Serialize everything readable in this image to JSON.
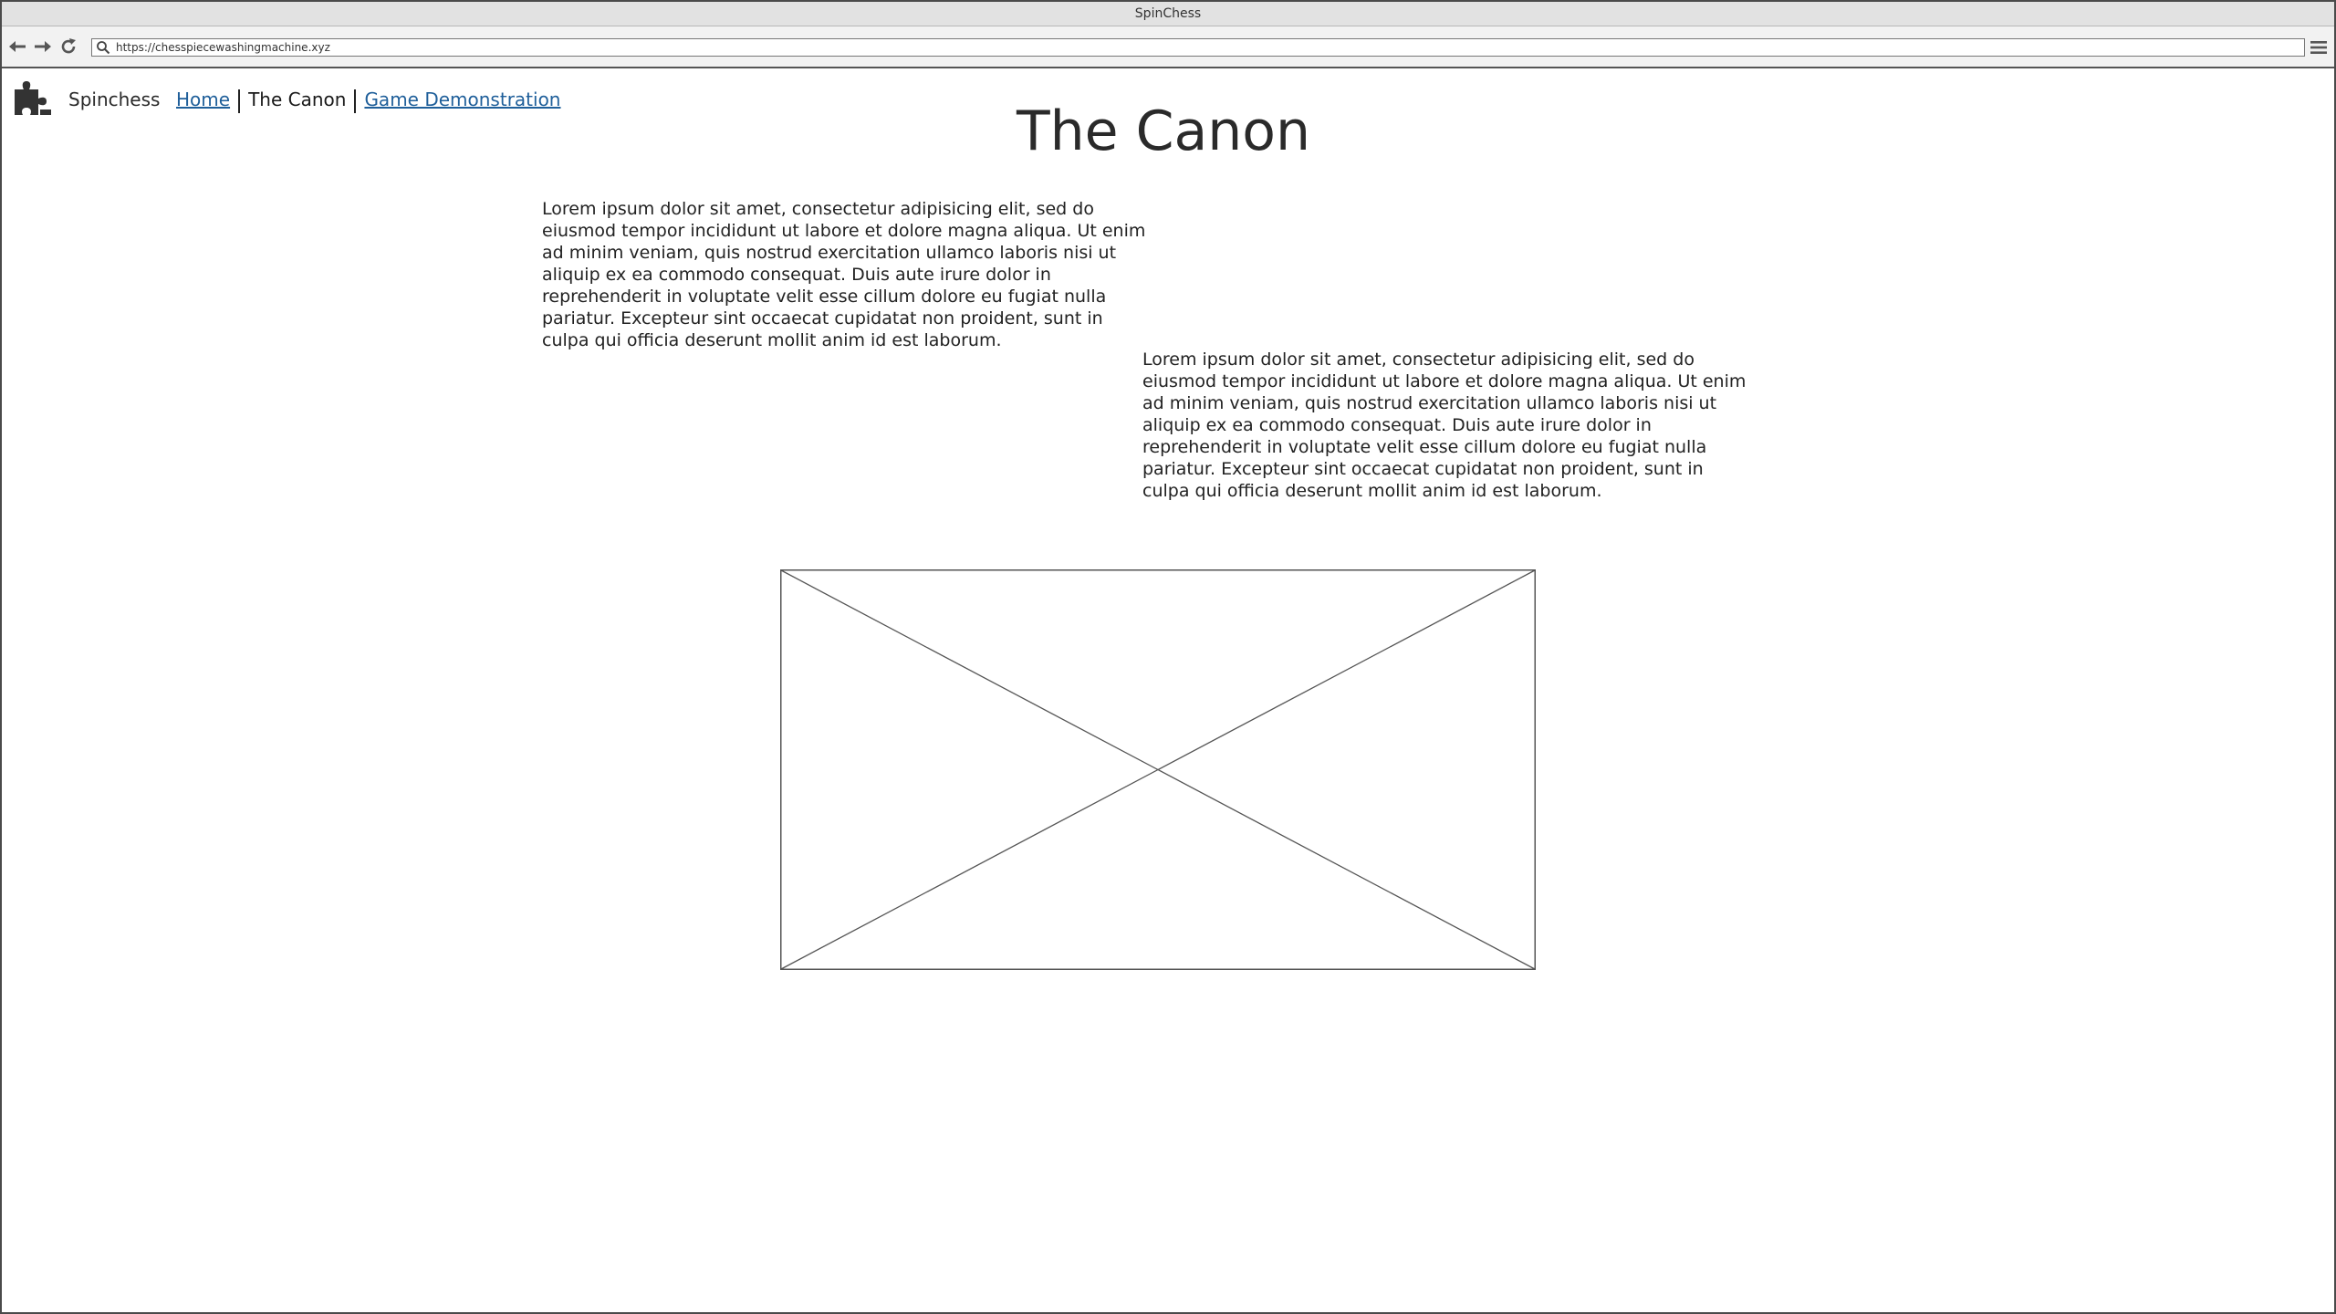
{
  "browser": {
    "window_title": "SpinChess",
    "url": "https://chesspiecewashingmachine.xyz",
    "icons": {
      "back": "back-arrow-icon",
      "forward": "forward-arrow-icon",
      "reload": "reload-icon",
      "search": "search-icon",
      "menu": "hamburger-menu-icon"
    }
  },
  "site": {
    "logo_icon": "puzzle-piece-icon",
    "brand": "Spinchess",
    "nav": {
      "home": "Home",
      "canon": "The Canon",
      "demo": "Game Demonstration"
    }
  },
  "main": {
    "title": "The Canon",
    "paragraphs": [
      "Lorem ipsum dolor sit amet, consectetur adipisicing elit, sed do eiusmod tempor incididunt ut labore et dolore magna aliqua. Ut enim ad minim veniam, quis nostrud exercitation ullamco laboris nisi ut aliquip ex ea commodo consequat. Duis aute irure dolor in reprehenderit in voluptate velit esse cillum dolore eu fugiat nulla pariatur. Excepteur sint occaecat cupidatat non proident, sunt in culpa qui officia deserunt mollit anim id est laborum.",
      "Lorem ipsum dolor sit amet, consectetur adipisicing elit, sed do eiusmod tempor incididunt ut labore et dolore magna aliqua. Ut enim ad minim veniam, quis nostrud exercitation ullamco laboris nisi ut aliquip ex ea commodo consequat. Duis aute irure dolor in reprehenderit in voluptate velit esse cillum dolore eu fugiat nulla pariatur. Excepteur sint occaecat cupidatat non proident, sunt in culpa qui officia deserunt mollit anim id est laborum."
    ]
  },
  "colors": {
    "link": "#1f5f9a",
    "text": "#222222",
    "chrome": "#e2e2e2"
  }
}
